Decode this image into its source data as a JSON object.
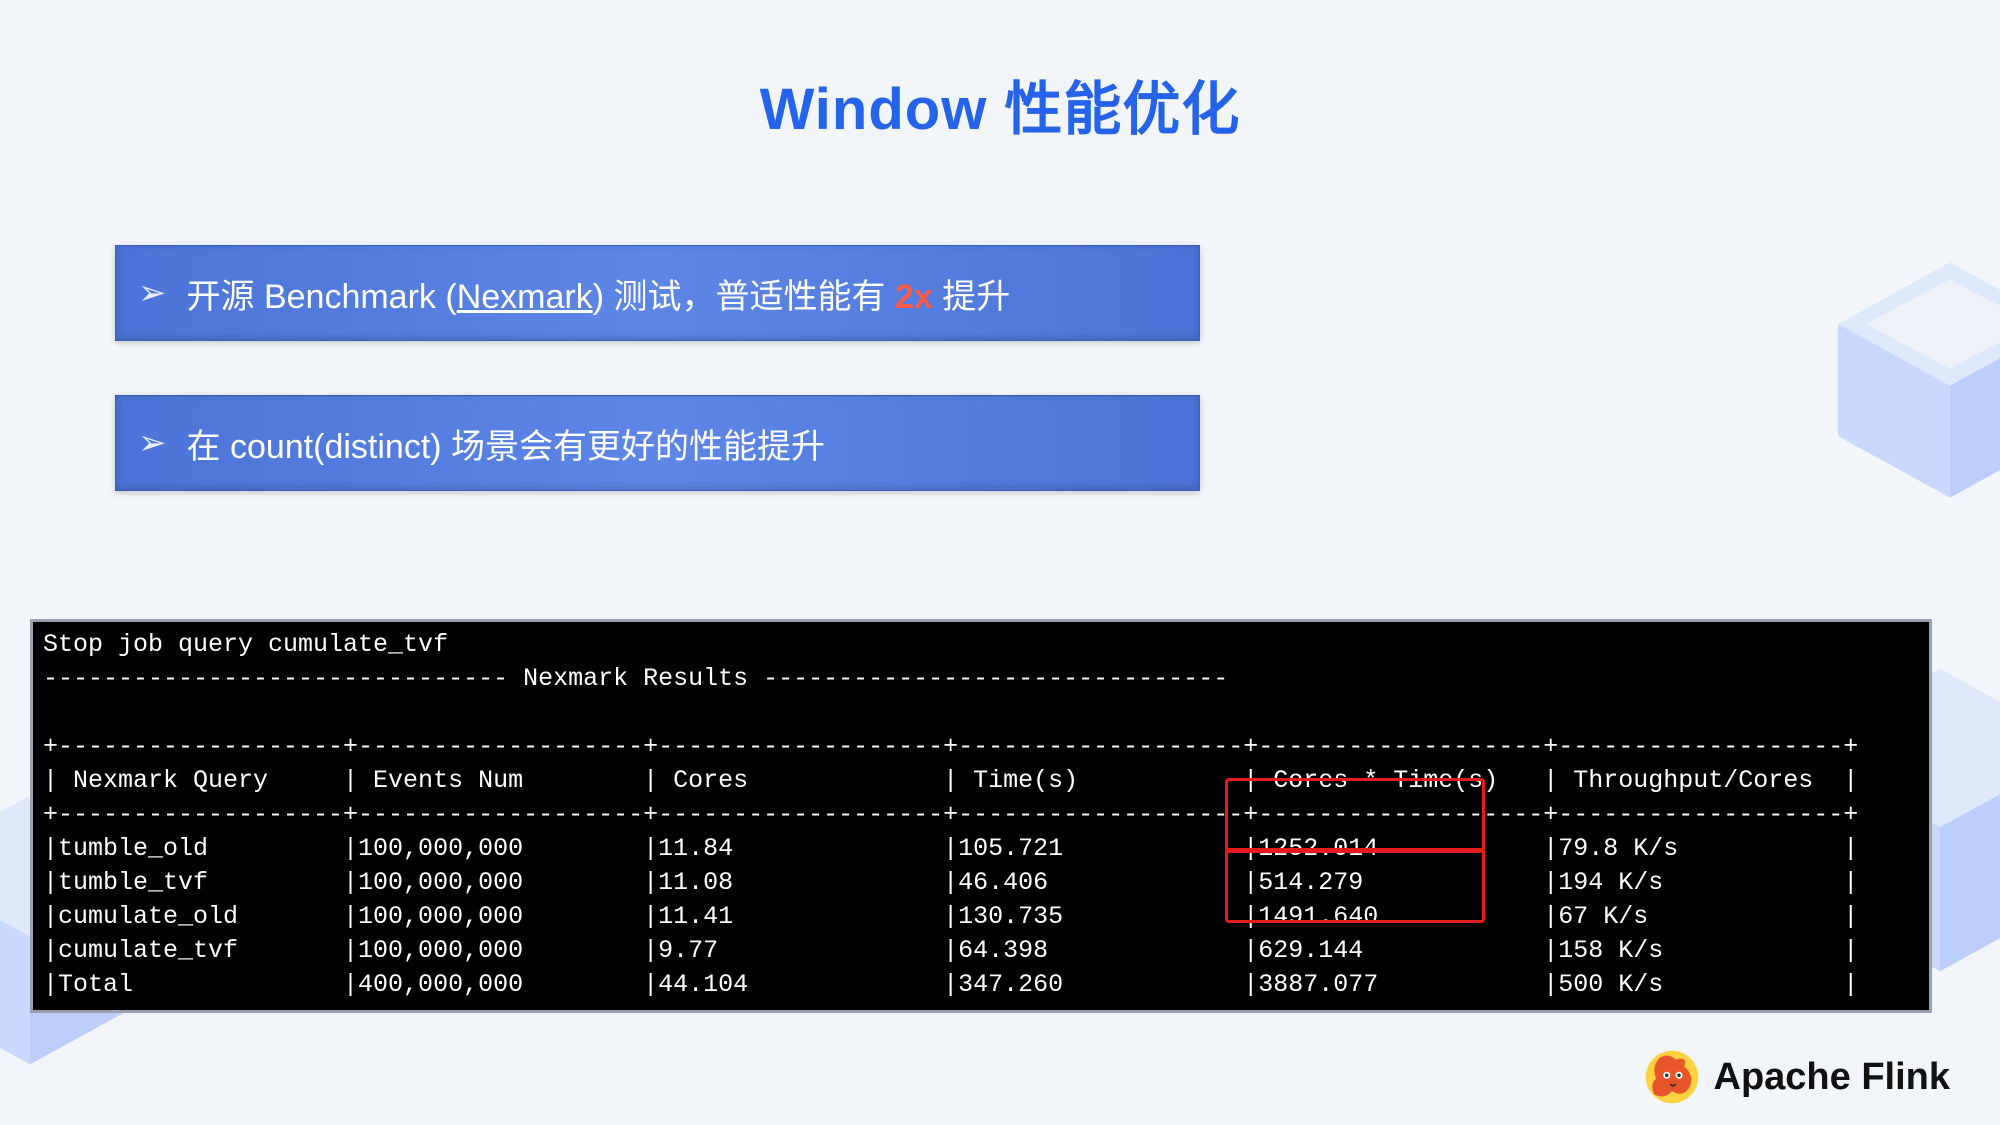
{
  "title": "Window 性能优化",
  "bullets": {
    "one_prefix": "开源 Benchmark (",
    "one_link": "Nexmark",
    "one_mid": ") 测试，普适性能有 ",
    "one_hl": "2x",
    "one_suffix": " 提升",
    "two": "在 count(distinct) 场景会有更好的性能提升"
  },
  "terminal": {
    "stop_line": "Stop job query cumulate_tvf",
    "results_hdr": "------------------------------- Nexmark Results -------------------------------",
    "columns": [
      "Nexmark Query",
      "Events Num",
      "Cores",
      "Time(s)",
      "Cores * Time(s)",
      "Throughput/Cores"
    ],
    "rows": [
      {
        "query": "tumble_old",
        "events": "100,000,000",
        "cores": "11.84",
        "time": "105.721",
        "cxt": "1252.014",
        "tp": "79.8 K/s"
      },
      {
        "query": "tumble_tvf",
        "events": "100,000,000",
        "cores": "11.08",
        "time": "46.406",
        "cxt": "514.279",
        "tp": "194 K/s"
      },
      {
        "query": "cumulate_old",
        "events": "100,000,000",
        "cores": "11.41",
        "time": "130.735",
        "cxt": "1491.640",
        "tp": "67 K/s"
      },
      {
        "query": "cumulate_tvf",
        "events": "100,000,000",
        "cores": "9.77",
        "time": "64.398",
        "cxt": "629.144",
        "tp": "158 K/s"
      },
      {
        "query": "Total",
        "events": "400,000,000",
        "cores": "44.104",
        "time": "347.260",
        "cxt": "3887.077",
        "tp": "500 K/s"
      }
    ]
  },
  "footer": {
    "brand": "Apache Flink"
  },
  "chart_data": {
    "type": "table",
    "title": "Nexmark Results",
    "columns": [
      "Nexmark Query",
      "Events Num",
      "Cores",
      "Time(s)",
      "Cores * Time(s)",
      "Throughput/Cores"
    ],
    "rows": [
      [
        "tumble_old",
        "100,000,000",
        11.84,
        105.721,
        1252.014,
        "79.8 K/s"
      ],
      [
        "tumble_tvf",
        "100,000,000",
        11.08,
        46.406,
        514.279,
        "194 K/s"
      ],
      [
        "cumulate_old",
        "100,000,000",
        11.41,
        130.735,
        1491.64,
        "67 K/s"
      ],
      [
        "cumulate_tvf",
        "100,000,000",
        9.77,
        64.398,
        629.144,
        "158 K/s"
      ],
      [
        "Total",
        "400,000,000",
        44.104,
        347.26,
        3887.077,
        "500 K/s"
      ]
    ],
    "highlight_column": "Cores * Time(s)",
    "highlight_pairs": [
      [
        "tumble_old",
        "tumble_tvf"
      ],
      [
        "cumulate_old",
        "cumulate_tvf"
      ]
    ]
  }
}
